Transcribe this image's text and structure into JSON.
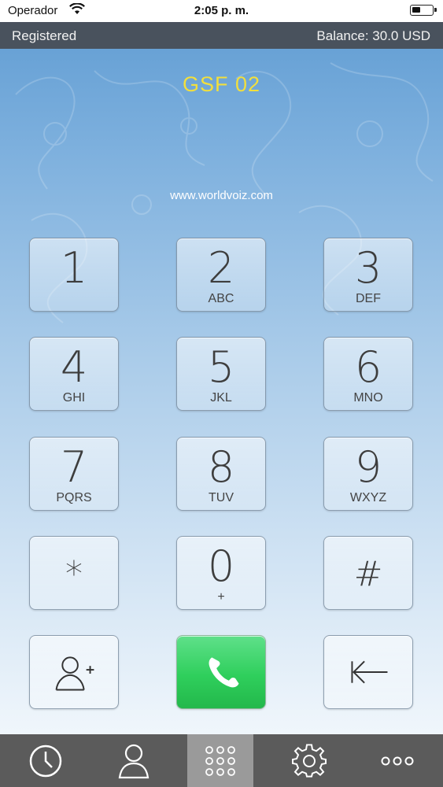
{
  "status_bar": {
    "carrier": "Operador",
    "time": "2:05 p. m."
  },
  "info_bar": {
    "registration_status": "Registered",
    "balance": "Balance: 30.0 USD"
  },
  "display": {
    "number": "GSF 02",
    "website": "www.worldvoiz.com"
  },
  "keypad": {
    "keys": [
      {
        "digit": "1",
        "letters": ""
      },
      {
        "digit": "2",
        "letters": "ABC"
      },
      {
        "digit": "3",
        "letters": "DEF"
      },
      {
        "digit": "4",
        "letters": "GHI"
      },
      {
        "digit": "5",
        "letters": "JKL"
      },
      {
        "digit": "6",
        "letters": "MNO"
      },
      {
        "digit": "7",
        "letters": "PQRS"
      },
      {
        "digit": "8",
        "letters": "TUV"
      },
      {
        "digit": "9",
        "letters": "WXYZ"
      },
      {
        "digit": "*",
        "letters": ""
      },
      {
        "digit": "0",
        "letters": "+"
      },
      {
        "digit": "#",
        "letters": ""
      }
    ],
    "actions": {
      "add_contact_icon": "add-contact-icon",
      "call_icon": "phone-icon",
      "backspace_icon": "backspace-icon"
    }
  },
  "tab_bar": {
    "tabs": [
      {
        "icon": "clock-icon",
        "active": false
      },
      {
        "icon": "person-icon",
        "active": false
      },
      {
        "icon": "keypad-icon",
        "active": true
      },
      {
        "icon": "gear-icon",
        "active": false
      },
      {
        "icon": "more-icon",
        "active": false
      }
    ]
  },
  "colors": {
    "display_number": "#f2df3c",
    "call_button": "#2fcf5c",
    "tab_bar": "#5b5b5b",
    "active_tab": "#9a9a9a"
  }
}
